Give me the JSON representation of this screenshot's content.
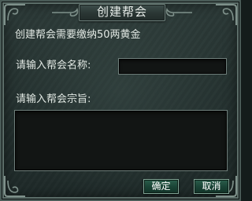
{
  "dialog": {
    "title": "创建帮会",
    "notice": "创建帮会需要缴纳50两黄金",
    "name_label": "请输入帮会名称:",
    "name_value": "",
    "purpose_label": "请输入帮会宗旨:",
    "purpose_value": "",
    "ok_label": "确定",
    "cancel_label": "取消"
  },
  "icons": {
    "corners": "corner-ornament-icon",
    "title_wings": "title-wing-ornament-icon"
  },
  "colors": {
    "frame": "#4a5b57",
    "panel": "#253230",
    "text": "#e2e9e4",
    "button": "#1b4537",
    "input_bg": "#121514"
  }
}
